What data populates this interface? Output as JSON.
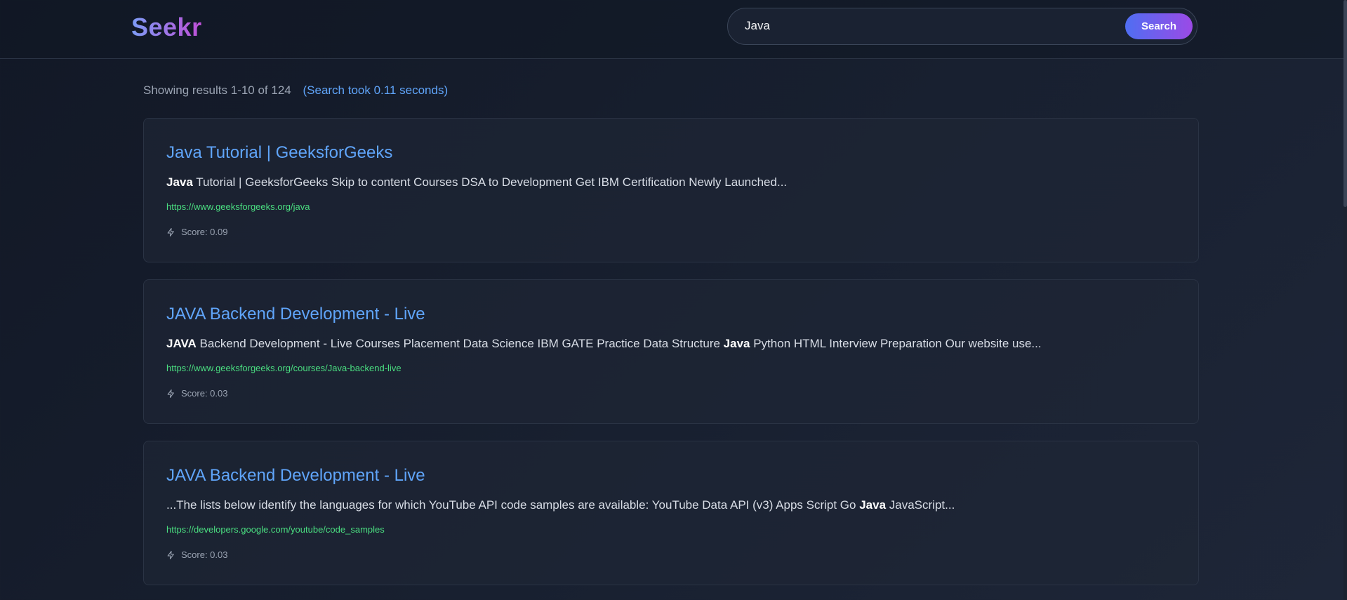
{
  "brand": {
    "name": "Seekr"
  },
  "search": {
    "query": "Java",
    "button_label": "Search"
  },
  "results_meta": {
    "summary": "Showing results 1-10 of 124",
    "timing": "(Search took 0.11 seconds)"
  },
  "results": [
    {
      "title": "Java Tutorial | GeeksforGeeks",
      "snippet": [
        {
          "text": "Java",
          "bold": true
        },
        {
          "text": " Tutorial | GeeksforGeeks Skip to content Courses DSA to Development Get IBM Certification Newly Launched...",
          "bold": false
        }
      ],
      "url": "https://www.geeksforgeeks.org/java",
      "score": "Score: 0.09"
    },
    {
      "title": "JAVA Backend Development - Live",
      "snippet": [
        {
          "text": "JAVA",
          "bold": true
        },
        {
          "text": " Backend Development - Live Courses Placement Data Science IBM GATE Practice Data Structure ",
          "bold": false
        },
        {
          "text": "Java",
          "bold": true
        },
        {
          "text": " Python HTML Interview Preparation Our website use...",
          "bold": false
        }
      ],
      "url": "https://www.geeksforgeeks.org/courses/Java-backend-live",
      "score": "Score: 0.03"
    },
    {
      "title": "JAVA Backend Development - Live",
      "snippet": [
        {
          "text": "...The lists below identify the languages for which YouTube API code samples are available: YouTube Data API (v3) Apps Script Go ",
          "bold": false
        },
        {
          "text": "Java",
          "bold": true
        },
        {
          "text": " JavaScript...",
          "bold": false
        }
      ],
      "url": "https://developers.google.com/youtube/code_samples",
      "score": "Score: 0.03"
    }
  ],
  "icons": {
    "score": "lightning-bolt-icon"
  },
  "colors": {
    "accent": "#60a5fa",
    "url": "#4ade80",
    "brand_gradient_start": "#7c9cf5",
    "brand_gradient_end": "#c04fd8",
    "button_gradient_start": "#4f6ef2",
    "button_gradient_end": "#9b4ae6"
  }
}
